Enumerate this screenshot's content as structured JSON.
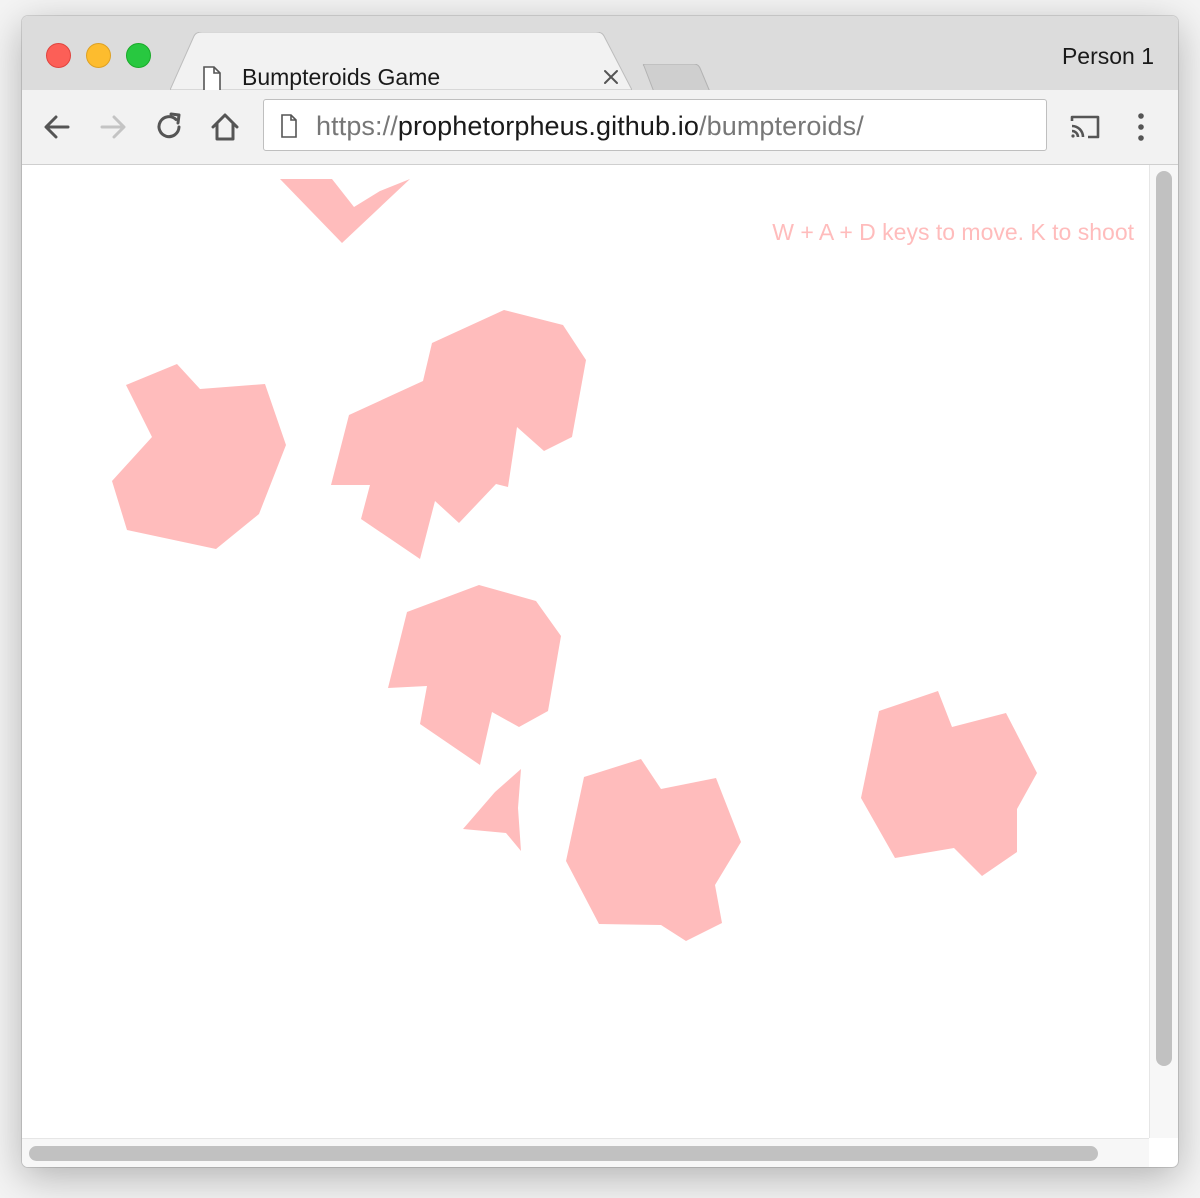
{
  "browser": {
    "tab": {
      "title": "Bumpteroids Game",
      "page_icon": "document-icon",
      "close_icon": "close-icon"
    },
    "new_tab_icon": "new-tab-icon",
    "profile": "Person 1",
    "nav": {
      "back_icon": "back-arrow-icon",
      "forward_icon": "forward-arrow-icon",
      "reload_icon": "reload-icon",
      "home_icon": "home-icon",
      "cast_icon": "cast-icon",
      "menu_icon": "kebab-menu-icon"
    },
    "address_bar": {
      "scheme": "https://",
      "host": "prophetorpheus.github.io",
      "path": "/bumpteroids/"
    }
  },
  "game": {
    "instructions": "W + A + D keys to move. K to shoot",
    "colors": {
      "asteroid": "#ffbcbc",
      "ship": "#ffbcbc",
      "text": "#ffbcbc",
      "background": "#ffffff"
    }
  }
}
